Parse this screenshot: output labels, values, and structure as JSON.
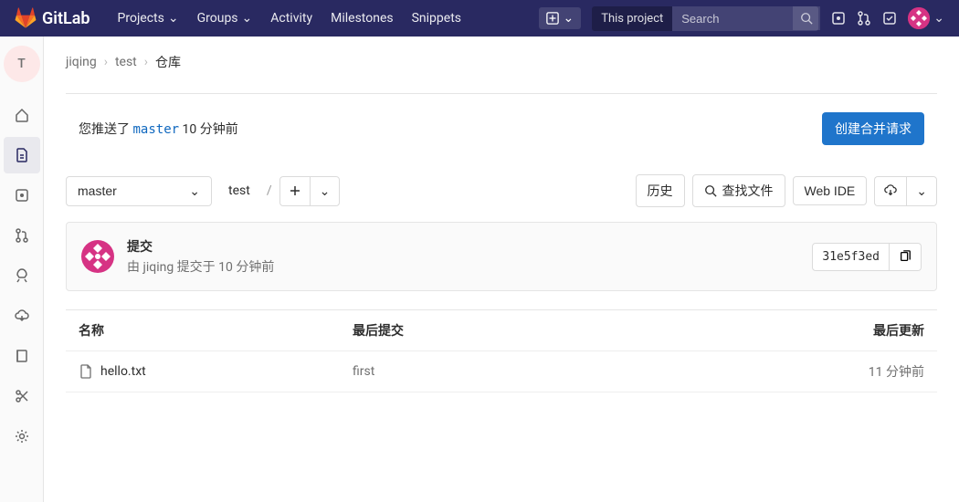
{
  "header": {
    "brand": "GitLab",
    "nav": {
      "projects": "Projects",
      "groups": "Groups",
      "activity": "Activity",
      "milestones": "Milestones",
      "snippets": "Snippets"
    },
    "search_scope": "This project",
    "search_placeholder": "Search"
  },
  "sidebar": {
    "project_letter": "T"
  },
  "breadcrumb": {
    "group": "jiqing",
    "project": "test",
    "page": "仓库"
  },
  "push_banner": {
    "prefix": "您推送了 ",
    "branch": "master",
    "suffix": " 10 分钟前",
    "mr_button": "创建合并请求"
  },
  "toolbar": {
    "branch": "master",
    "path": "test",
    "sep": "/",
    "history": "历史",
    "find_file": "查找文件",
    "web_ide": "Web IDE"
  },
  "commit": {
    "title": "提交",
    "by_prefix": "由 ",
    "author": "jiqing",
    "by_suffix": " 提交于 10 分钟前",
    "sha": "31e5f3ed"
  },
  "file_table": {
    "headers": {
      "name": "名称",
      "last_commit": "最后提交",
      "last_update": "最后更新"
    },
    "rows": [
      {
        "name": "hello.txt",
        "commit": "first",
        "updated": "11 分钟前"
      }
    ]
  }
}
